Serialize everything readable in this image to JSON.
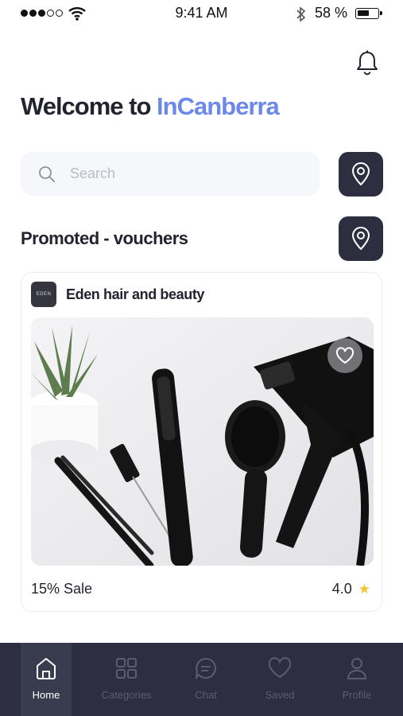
{
  "status": {
    "time": "9:41 AM",
    "battery": "58 %"
  },
  "header": {
    "welcome_prefix": "Welcome to ",
    "brand": "InCanberra"
  },
  "search": {
    "placeholder": "Search"
  },
  "promoted": {
    "title": "Promoted - vouchers",
    "card": {
      "store_logo_text": "EDEN",
      "store_name": "Eden hair and beauty",
      "offer": "15% Sale",
      "rating": "4.0"
    }
  },
  "tabs": [
    {
      "label": "Home",
      "icon": "home-icon",
      "active": true
    },
    {
      "label": "Categories",
      "icon": "grid-icon",
      "active": false
    },
    {
      "label": "Chat",
      "icon": "chat-icon",
      "active": false
    },
    {
      "label": "Saved",
      "icon": "heart-icon",
      "active": false
    },
    {
      "label": "Profile",
      "icon": "user-icon",
      "active": false
    }
  ],
  "colors": {
    "accent": "#6c88ea",
    "dark": "#2d2f40",
    "star": "#f5c12e"
  }
}
